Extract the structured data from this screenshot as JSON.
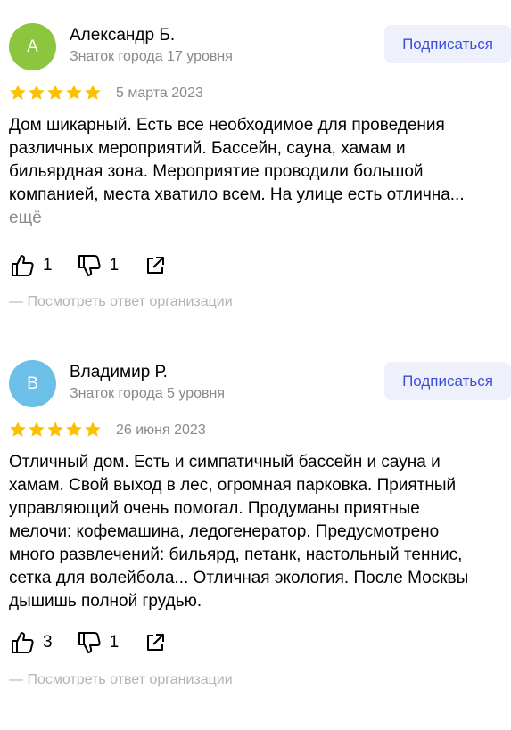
{
  "colors": {
    "avatar1": "#8cc63f",
    "avatar2": "#6cc0e8",
    "star": "#fcc000",
    "accent": "#3b4fd8",
    "button_bg": "#eef0fb",
    "muted": "#8a8a8a"
  },
  "reviews": [
    {
      "avatar_letter": "А",
      "author": "Александр Б.",
      "level": "Знаток города 17 уровня",
      "subscribe_label": "Подписаться",
      "rating": 5,
      "date": "5 марта 2023",
      "text_lines": [
        "Дом шикарный. Есть все необходимое для проведения",
        "различных мероприятий. Бассейн, сауна, хамам и",
        "бильярдная зона. Мероприятие проводили большой",
        "компанией, места хватило всем. На улице есть отлична..."
      ],
      "more_label": "ещё",
      "likes": "1",
      "dislikes": "1",
      "org_answer_label": "— Посмотреть ответ организации"
    },
    {
      "avatar_letter": "В",
      "author": "Владимир Р.",
      "level": "Знаток города 5 уровня",
      "subscribe_label": "Подписаться",
      "rating": 5,
      "date": "26 июня 2023",
      "text_lines": [
        "Отличный дом. Есть и симпатичный бассейн и сауна и",
        "хамам. Свой выход в лес, огромная парковка. Приятный",
        "управляющий очень помогал. Продуманы приятные",
        "мелочи: кофемашина, ледогенератор. Предусмотрено",
        "много развлечений: бильярд, петанк, настольный теннис,",
        "сетка для волейбола... Отличная экология. После Москвы",
        "дышишь полной грудью."
      ],
      "more_label": "",
      "likes": "3",
      "dislikes": "1",
      "org_answer_label": "— Посмотреть ответ организации"
    }
  ],
  "icons": {
    "star": "star-icon",
    "like": "thumbs-up-icon",
    "dislike": "thumbs-down-icon",
    "share": "share-icon"
  }
}
